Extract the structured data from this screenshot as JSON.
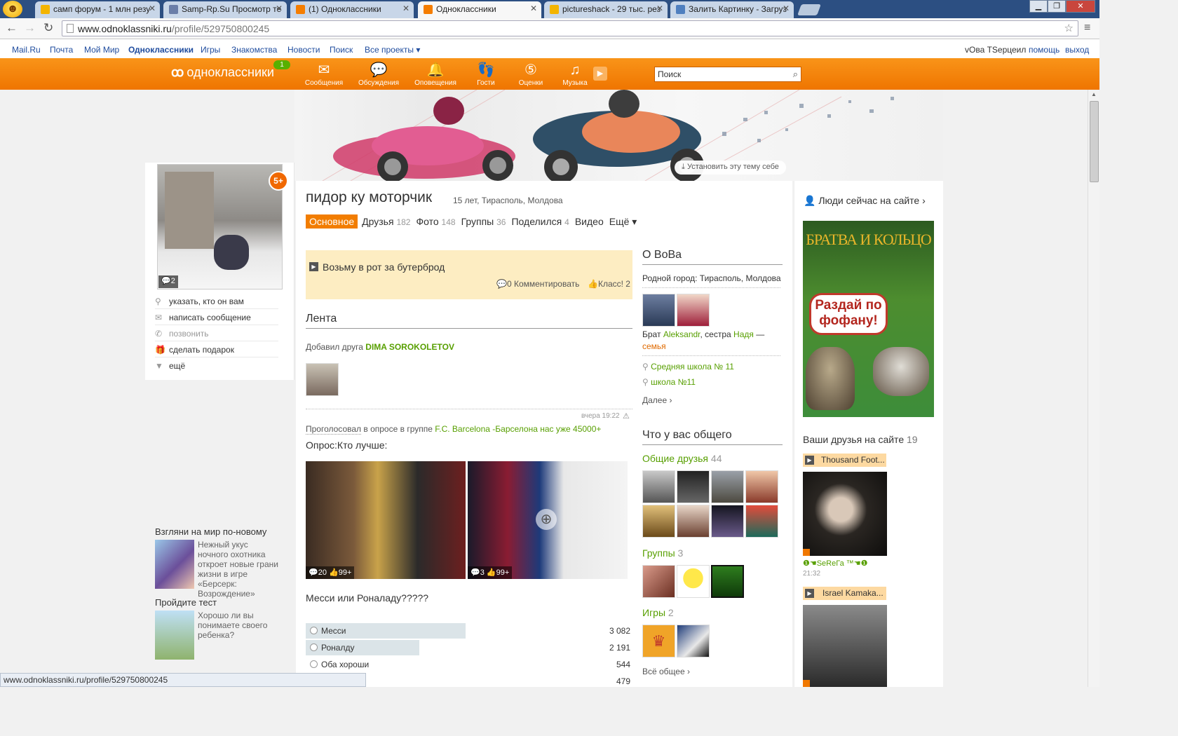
{
  "browser": {
    "tabs": [
      {
        "title": "самп форум - 1 млн резу",
        "active": false
      },
      {
        "title": "Samp-Rp.Su Просмотр те",
        "active": false
      },
      {
        "title": "(1) Одноклассники",
        "active": false
      },
      {
        "title": "Одноклассники",
        "active": true
      },
      {
        "title": "pictureshack - 29 тыс. рез",
        "active": false
      },
      {
        "title": "Залить Картинку - Загруз",
        "active": false
      }
    ],
    "url_domain": "www.odnoklassniki.ru",
    "url_path": "/profile/529750800245",
    "status_url": "www.odnoklassniki.ru/profile/529750800245"
  },
  "mailru_bar": {
    "links": [
      "Mail.Ru",
      "Почта",
      "Мой Мир",
      "Одноклассники",
      "Игры",
      "Знакомства",
      "Новости",
      "Поиск",
      "Все проекты ▾"
    ],
    "user": "vOва TSерцеил",
    "help": "помощь",
    "logout": "выход"
  },
  "header": {
    "logo": "одноклассники",
    "logo_badge": "1",
    "nav": [
      {
        "label": "Сообщения",
        "icon": "envelope-icon"
      },
      {
        "label": "Обсуждения",
        "icon": "chat-bubbles-icon"
      },
      {
        "label": "Оповещения",
        "icon": "bell-icon"
      },
      {
        "label": "Гости",
        "icon": "footprints-icon"
      },
      {
        "label": "Оценки",
        "icon": "rating-icon"
      },
      {
        "label": "Музыка",
        "icon": "music-note-icon"
      }
    ],
    "search_placeholder": "Поиск",
    "colors": {
      "header": "#f57d00",
      "link": "#579f00"
    }
  },
  "cover": {
    "install_theme": "Установить эту тему себе"
  },
  "profile": {
    "name": "пидор ку моторчик",
    "meta": "15 лет, Тирасполь, Молдова",
    "avatar_badge": "5+",
    "avatar_comments": "2",
    "tabs": [
      {
        "label": "Основное",
        "count": ""
      },
      {
        "label": "Друзья",
        "count": "182"
      },
      {
        "label": "Фото",
        "count": "148"
      },
      {
        "label": "Группы",
        "count": "36"
      },
      {
        "label": "Поделился",
        "count": "4"
      },
      {
        "label": "Видео",
        "count": ""
      },
      {
        "label": "Ещё ▾",
        "count": ""
      }
    ],
    "actions": [
      "указать, кто он вам",
      "написать сообщение",
      "позвонить",
      "сделать подарок",
      "ещё"
    ]
  },
  "status": {
    "text": "Возьму в рот за бутерброд",
    "comments": "0 Комментировать",
    "likes": "Класс! 2"
  },
  "feed": {
    "title": "Лента",
    "item1_prefix": "Добавил друга",
    "item1_name": "DIMA SOROKOLETOV",
    "item1_time": "вчера 19:22",
    "item2_action": "Проголосовал",
    "item2_middle": "в опросе в группе",
    "item2_group": "F.C. Barcelona -Барселона нас уже 45000+",
    "poll_title": "Опрос:Кто лучше:",
    "photo1_comments": "20",
    "photo1_likes": "99+",
    "photo2_comments": "3",
    "photo2_likes": "99+",
    "question": "Месси или Роналаду?????",
    "options": [
      {
        "label": "Месси",
        "count": "3 082",
        "share": 0.49
      },
      {
        "label": "Роналду",
        "count": "2 191",
        "share": 0.35
      },
      {
        "label": "Оба хороши",
        "count": "544",
        "share": 0.09
      },
      {
        "label": "",
        "count": "479",
        "share": 0.08
      }
    ]
  },
  "about": {
    "title": "О ВоВа",
    "hometown": "Родной город: Тирасполь, Молдова",
    "family_prefix": "Брат",
    "brother": "Aleksandr",
    "sister_prefix": ", сестра",
    "sister": "Надя",
    "family_suffix": " —",
    "family_word": "семья",
    "schools": [
      "Средняя школа № 11",
      "школа №11"
    ],
    "more": "Далее ›"
  },
  "common": {
    "title": "Что у вас общего",
    "friends_label": "Общие друзья",
    "friends_count": "44",
    "groups_label": "Группы",
    "groups_count": "3",
    "games_label": "Игры",
    "games_count": "2",
    "all": "Всё общее ›"
  },
  "left_ads": {
    "ad1_title": "Взгляни на мир по-новому",
    "ad1_text": "Нежный укус ночного охотника откроет новые грани жизни в игре «Берсерк: Возрождение»",
    "ad2_title": "Пройдите тест",
    "ad2_text": "Хорошо ли вы понимаете своего ребенка?"
  },
  "right": {
    "people_online": "Люди сейчас на сайте ›",
    "banner_title": "БРАТВА И КОЛЬЦО",
    "banner_bubble": "Раздай по фофану!",
    "friends_online_label": "Ваши друзья на сайте",
    "friends_online_count": "19",
    "friend1_song": "Thousand Foot...",
    "friend1_name": "❶☚SeReГа ™☚❶",
    "friend1_time": "21:32",
    "friend2_song": "Israel Kamaka..."
  }
}
